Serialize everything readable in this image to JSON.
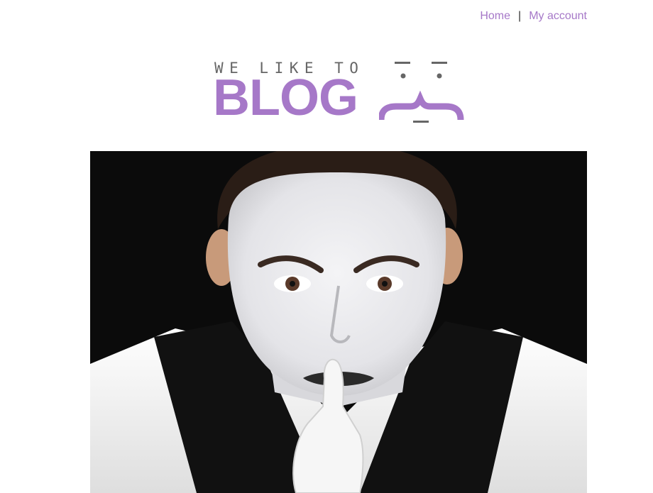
{
  "nav": {
    "home_label": "Home",
    "separator": "|",
    "account_label": "My account"
  },
  "logo": {
    "tagline": "WE LIKE TO",
    "word": "BLOG",
    "accent_color": "#a678c8",
    "tagline_color": "#666666"
  },
  "hero": {
    "image": "mime-face-finger-on-lips"
  },
  "colors": {
    "link": "#a678c8",
    "background": "#ffffff",
    "hero_background": "#0b0b0b"
  }
}
